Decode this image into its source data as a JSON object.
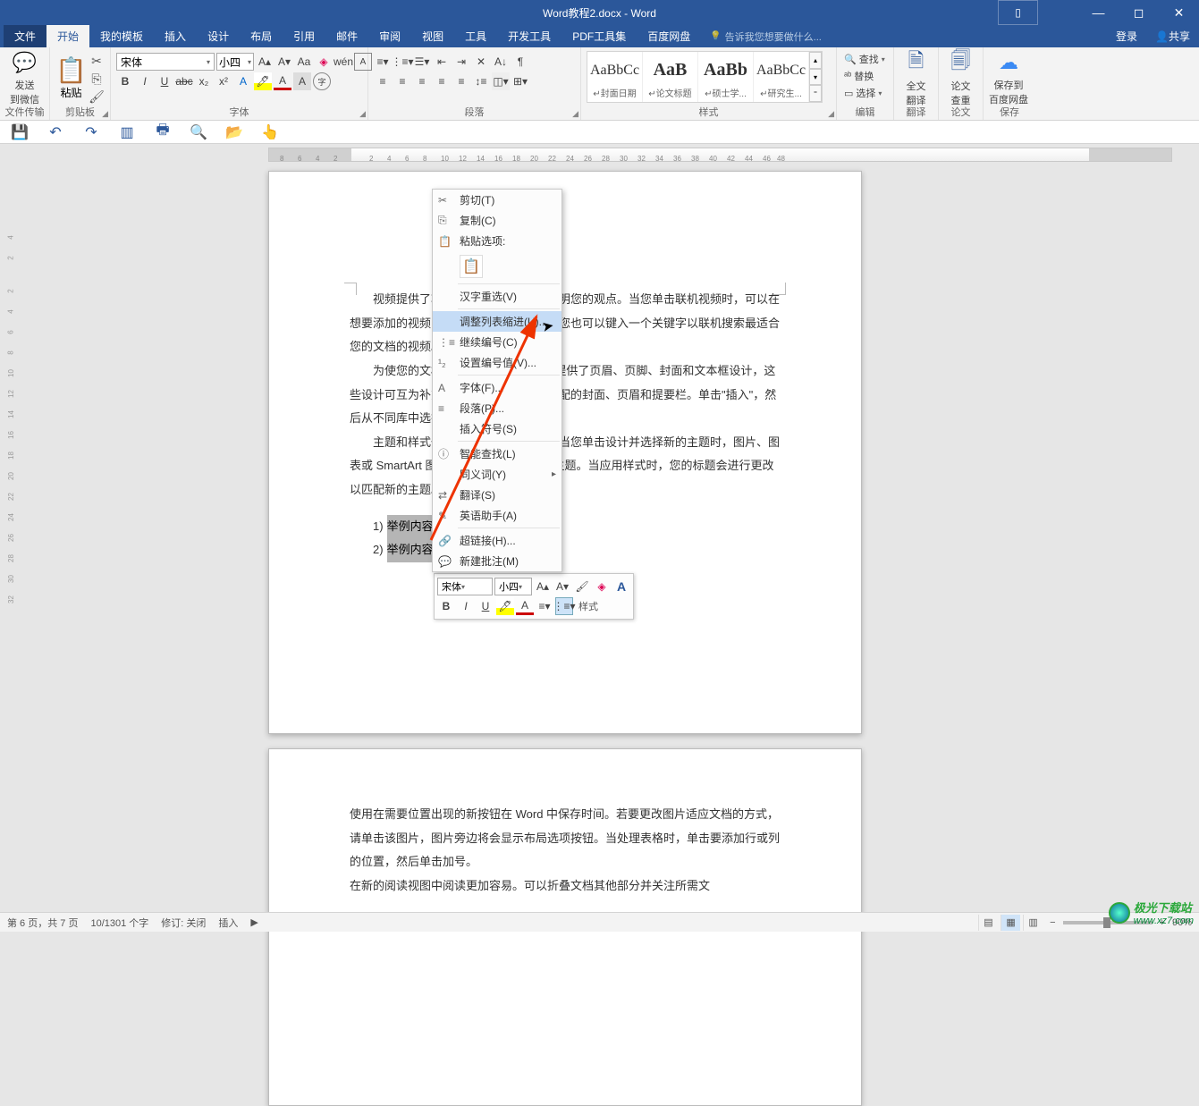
{
  "title": "Word教程2.docx - Word",
  "window_buttons": {
    "ribbon_opts": "▯",
    "min": "—",
    "max": "◻",
    "close": "✕"
  },
  "tabs": {
    "file": "文件",
    "items": [
      "开始",
      "我的模板",
      "插入",
      "设计",
      "布局",
      "引用",
      "邮件",
      "审阅",
      "视图",
      "工具",
      "开发工具",
      "PDF工具集",
      "百度网盘"
    ],
    "active_index": 0,
    "tellme": "告诉我您想要做什么...",
    "login": "登录",
    "share": "共享"
  },
  "ribbon": {
    "send_wechat": "发送\n到微信",
    "group_filetransfer": "文件传输",
    "paste": "粘贴",
    "group_clipboard": "剪贴板",
    "font_name": "宋体",
    "font_size": "小四",
    "group_font": "字体",
    "group_para": "段落",
    "styles": [
      {
        "preview": "AaBbCc",
        "label": "↵封面日期"
      },
      {
        "preview": "AaB",
        "label": "↵论文标题",
        "big": true
      },
      {
        "preview": "AaBb",
        "label": "↵硕士学...",
        "big": true
      },
      {
        "preview": "AaBbCc",
        "label": "↵研究生..."
      }
    ],
    "group_styles": "样式",
    "edit_find": "查找",
    "edit_replace": "替换",
    "edit_select": "选择",
    "group_edit": "编辑",
    "translate": "全文\n翻译",
    "group_translate": "翻译",
    "review": "论文\n查重",
    "group_review": "论文",
    "save_cloud": "保存到\n百度网盘",
    "group_save": "保存"
  },
  "context_menu": {
    "cut": "剪切(T)",
    "copy": "复制(C)",
    "paste_label": "粘贴选项:",
    "hanzi": "汉字重选(V)",
    "adjust_indent": "调整列表缩进(U)...",
    "continue_num": "继续编号(C)",
    "set_num": "设置编号值(V)...",
    "font": "字体(F)...",
    "para": "段落(P)...",
    "insert_sym": "插入符号(S)",
    "smart_find": "智能查找(L)",
    "synonym": "同义词(Y)",
    "translate": "翻译(S)",
    "eng_assist": "英语助手(A)",
    "hyperlink": "超链接(H)...",
    "new_comment": "新建批注(M)"
  },
  "minibar": {
    "font": "宋体",
    "size": "小四",
    "style_label": "样式"
  },
  "document": {
    "para1": "视频提供了功能强大的方法帮助您证明您的观点。当您单击联机视频时，可以在想要添加的视频的嵌入代码中进行粘贴。您也可以键入一个关键字以联机搜索最适合您的文档的视频。",
    "para2": "为使您的文档具有专业外观，Word 提供了页眉、页脚、封面和文本框设计，这些设计可互为补充。例如，您可以添加匹配的封面、页眉和提要栏。单击\"插入\"，然后从不同库中选择所需元素。",
    "para3": "主题和样式也有助于文档保持协调。当您单击设计并选择新的主题时，图片、图表或 SmartArt 图形将会更改以匹配新的主题。当应用样式时，您的标题会进行更改以匹配新的主题。",
    "list": [
      {
        "num": "1)",
        "text": "举例内容"
      },
      {
        "num": "2)",
        "text": "举例内容"
      }
    ],
    "para4": "使用在需要位置出现的新按钮在 Word 中保存时间。若要更改图片适应文档的方式，请单击该图片，图片旁边将会显示布局选项按钮。当处理表格时，单击要添加行或列的位置，然后单击加号。",
    "para5_partial": "在新的阅读视图中阅读更加容易。可以折叠文档其他部分并关注所需文"
  },
  "status": {
    "page": "第 6 页，共 7 页",
    "words": "10/1301 个字",
    "track": "修订: 关闭",
    "insert": "插入",
    "zoom": "90%"
  },
  "watermark": {
    "name": "极光下载站",
    "url": "www.xz7.com"
  },
  "hruler_marks": [
    "8",
    "6",
    "4",
    "2",
    "",
    "2",
    "4",
    "6",
    "8",
    "10",
    "12",
    "14",
    "16",
    "18",
    "20",
    "22",
    "24",
    "26",
    "28",
    "30",
    "32",
    "34",
    "36",
    "38",
    "40",
    "42",
    "44",
    "46",
    "48"
  ]
}
